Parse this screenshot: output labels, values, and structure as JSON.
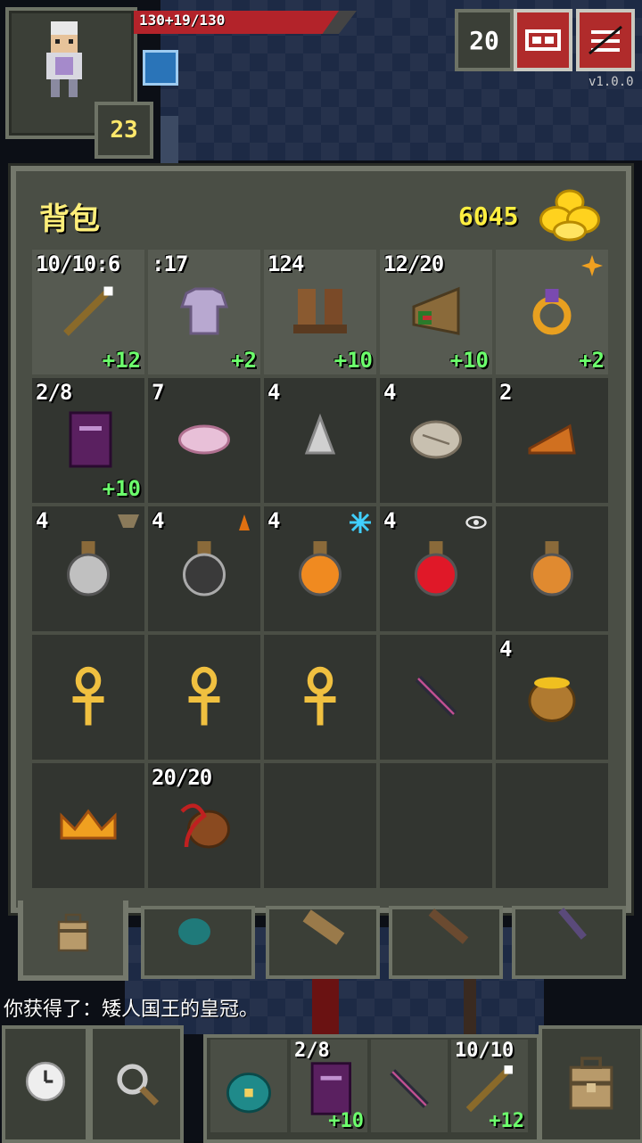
{
  "hud": {
    "hp_text": "130+19/130",
    "hero_level": "23",
    "depth": "20",
    "version": "v1.0.0",
    "hp_fraction": 1.0,
    "colors": {
      "hp": "#b3232a",
      "gold_text": "#ffef40",
      "level_text": "#6cff6c",
      "title": "#ffef7a"
    }
  },
  "inventory": {
    "title": "背包",
    "gold": "6045",
    "rows": [
      [
        {
          "name": "wand-icon",
          "qty": "10/10:6",
          "level": "+12",
          "equipped": true
        },
        {
          "name": "cloth-armor-icon",
          "qty": ":17",
          "level": "+2",
          "equipped": true
        },
        {
          "name": "boots-icon",
          "qty": "124",
          "level": "+10",
          "equipped": true
        },
        {
          "name": "horn-of-plenty-icon",
          "qty": "12/20",
          "level": "+10",
          "equipped": true
        },
        {
          "name": "ring-icon",
          "qty": "",
          "level": "+2",
          "equipped": true,
          "badge": "sparkle-icon"
        }
      ],
      [
        {
          "name": "spellbook-icon",
          "qty": "2/8",
          "level": "+10"
        },
        {
          "name": "mystery-meat-icon",
          "qty": "7",
          "level": ""
        },
        {
          "name": "stone-icon",
          "qty": "4",
          "level": ""
        },
        {
          "name": "ration-icon",
          "qty": "4",
          "level": ""
        },
        {
          "name": "pasty-icon",
          "qty": "2",
          "level": ""
        }
      ],
      [
        {
          "name": "potion-silver-icon",
          "qty": "4",
          "level": "",
          "badge": "shield-badge-icon"
        },
        {
          "name": "potion-charcoal-icon",
          "qty": "4",
          "level": "",
          "badge": "fire-badge-icon"
        },
        {
          "name": "potion-orange-icon",
          "qty": "4",
          "level": "",
          "badge": "frost-badge-icon"
        },
        {
          "name": "potion-red-icon",
          "qty": "4",
          "level": "",
          "badge": "eye-badge-icon"
        },
        {
          "name": "potion-amber-icon",
          "qty": "",
          "level": ""
        }
      ],
      [
        {
          "name": "ankh-icon",
          "qty": "",
          "level": ""
        },
        {
          "name": "ankh-icon",
          "qty": "",
          "level": ""
        },
        {
          "name": "ankh-icon",
          "qty": "",
          "level": ""
        },
        {
          "name": "dart-icon",
          "qty": "",
          "level": ""
        },
        {
          "name": "honey-pot-icon",
          "qty": "4",
          "level": ""
        }
      ],
      [
        {
          "name": "crown-icon",
          "qty": "",
          "level": ""
        },
        {
          "name": "chalice-whip-icon",
          "qty": "20/20",
          "level": ""
        },
        {
          "name": "empty-slot",
          "qty": "",
          "level": ""
        },
        {
          "name": "empty-slot",
          "qty": "",
          "level": ""
        },
        {
          "name": "empty-slot",
          "qty": "",
          "level": ""
        }
      ]
    ]
  },
  "log": {
    "message": "你获得了：矮人国王的皇冠。"
  },
  "quickslots": [
    {
      "name": "seed-pouch-icon",
      "qty": "",
      "level": ""
    },
    {
      "name": "spellbook-icon",
      "qty": "2/8",
      "level": "+10"
    },
    {
      "name": "dart-icon",
      "qty": "",
      "level": ""
    },
    {
      "name": "wand-icon",
      "qty": "10/10",
      "level": "+12"
    }
  ]
}
